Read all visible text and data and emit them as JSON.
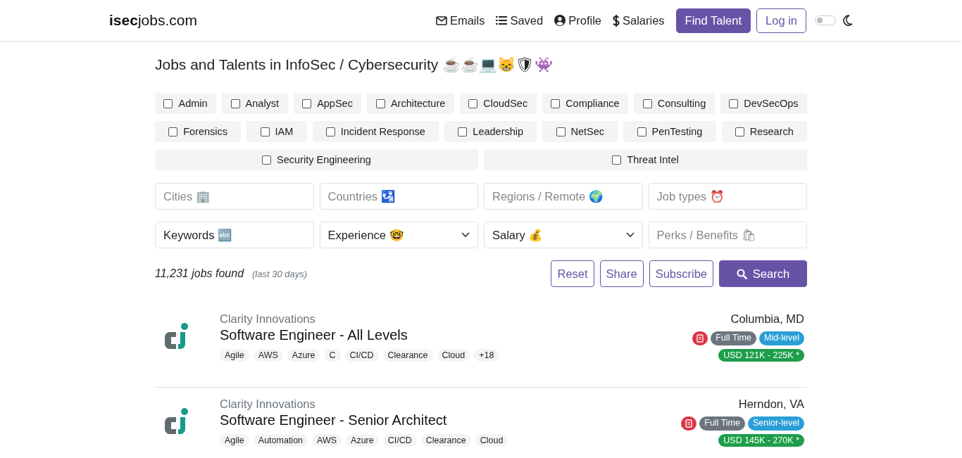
{
  "header": {
    "brand": "**isec**jobs.com",
    "nav": [
      {
        "kind": "envelope",
        "label": "Emails"
      },
      {
        "kind": "list",
        "label": "Saved"
      },
      {
        "kind": "user",
        "label": "Profile"
      },
      {
        "kind": "dollar",
        "label": "Salaries"
      }
    ],
    "find_talent": "Find Talent",
    "login": "Log in",
    "dark_mode": {
      "on": false
    }
  },
  "heading": "Jobs and Talents in InfoSec / Cybersecurity ☕☕💻😸🛡👾",
  "categories": [
    {
      "label": "Admin",
      "checked": false
    },
    {
      "label": "Analyst",
      "checked": false
    },
    {
      "label": "AppSec",
      "checked": false
    },
    {
      "label": "Architecture",
      "checked": false
    },
    {
      "label": "CloudSec",
      "checked": false
    },
    {
      "label": "Compliance",
      "checked": false
    },
    {
      "label": "Consulting",
      "checked": false
    },
    {
      "label": "DevSecOps",
      "checked": false
    },
    {
      "label": "Forensics",
      "checked": false
    },
    {
      "label": "IAM",
      "checked": false
    },
    {
      "label": "Incident Response",
      "checked": false
    },
    {
      "label": "Leadership",
      "checked": false
    },
    {
      "label": "NetSec",
      "checked": false
    },
    {
      "label": "PenTesting",
      "checked": false
    },
    {
      "label": "Research",
      "checked": false
    },
    {
      "label": "Security Engineering",
      "checked": false
    },
    {
      "label": "Threat Intel",
      "checked": false
    }
  ],
  "fields": [
    {
      "kind": "text",
      "placeholder": "Cities 🏢"
    },
    {
      "kind": "text",
      "placeholder": "Countries 🛂"
    },
    {
      "kind": "text",
      "placeholder": "Regions / Remote 🌍"
    },
    {
      "kind": "text",
      "placeholder": "Job types ⏰"
    },
    {
      "kind": "text",
      "value": "Keywords 🔤"
    },
    {
      "kind": "select",
      "value": "Experience 🤓"
    },
    {
      "kind": "select",
      "value": "Salary 💰"
    },
    {
      "kind": "text",
      "placeholder": "Perks / Benefits 🛍"
    }
  ],
  "results": {
    "count": "11,231 jobs found",
    "period": "(last 30 days)"
  },
  "actions": [
    "Reset",
    "Share",
    "Subscribe"
  ],
  "search": "Search",
  "jobs": [
    {
      "company": "Clarity Innovations",
      "title": "Software Engineer - All Levels",
      "tags": [
        "Agile",
        "AWS",
        "Azure",
        "C",
        "CI/CD",
        "Clearance",
        "Cloud",
        "+18"
      ],
      "location": "Columbia, MD",
      "badges": [
        {
          "kind": "icon",
          "color": "#dc3545"
        },
        {
          "kind": "text",
          "label": "Full Time",
          "color": "#6c757d"
        },
        {
          "kind": "text",
          "label": "Mid-level",
          "color": "#2a9fd6"
        }
      ],
      "salary": "USD 121K - 225K *"
    },
    {
      "company": "Clarity Innovations",
      "title": "Software Engineer - Senior Architect",
      "tags": [
        "Agile",
        "Automation",
        "AWS",
        "Azure",
        "CI/CD",
        "Clearance",
        "Cloud"
      ],
      "location": "Herndon, VA",
      "badges": [
        {
          "kind": "icon",
          "color": "#dc3545"
        },
        {
          "kind": "text",
          "label": "Full Time",
          "color": "#6c757d"
        },
        {
          "kind": "text",
          "label": "Senior-level",
          "color": "#2a9fd6"
        }
      ],
      "salary": "USD 145K - 270K *"
    }
  ]
}
